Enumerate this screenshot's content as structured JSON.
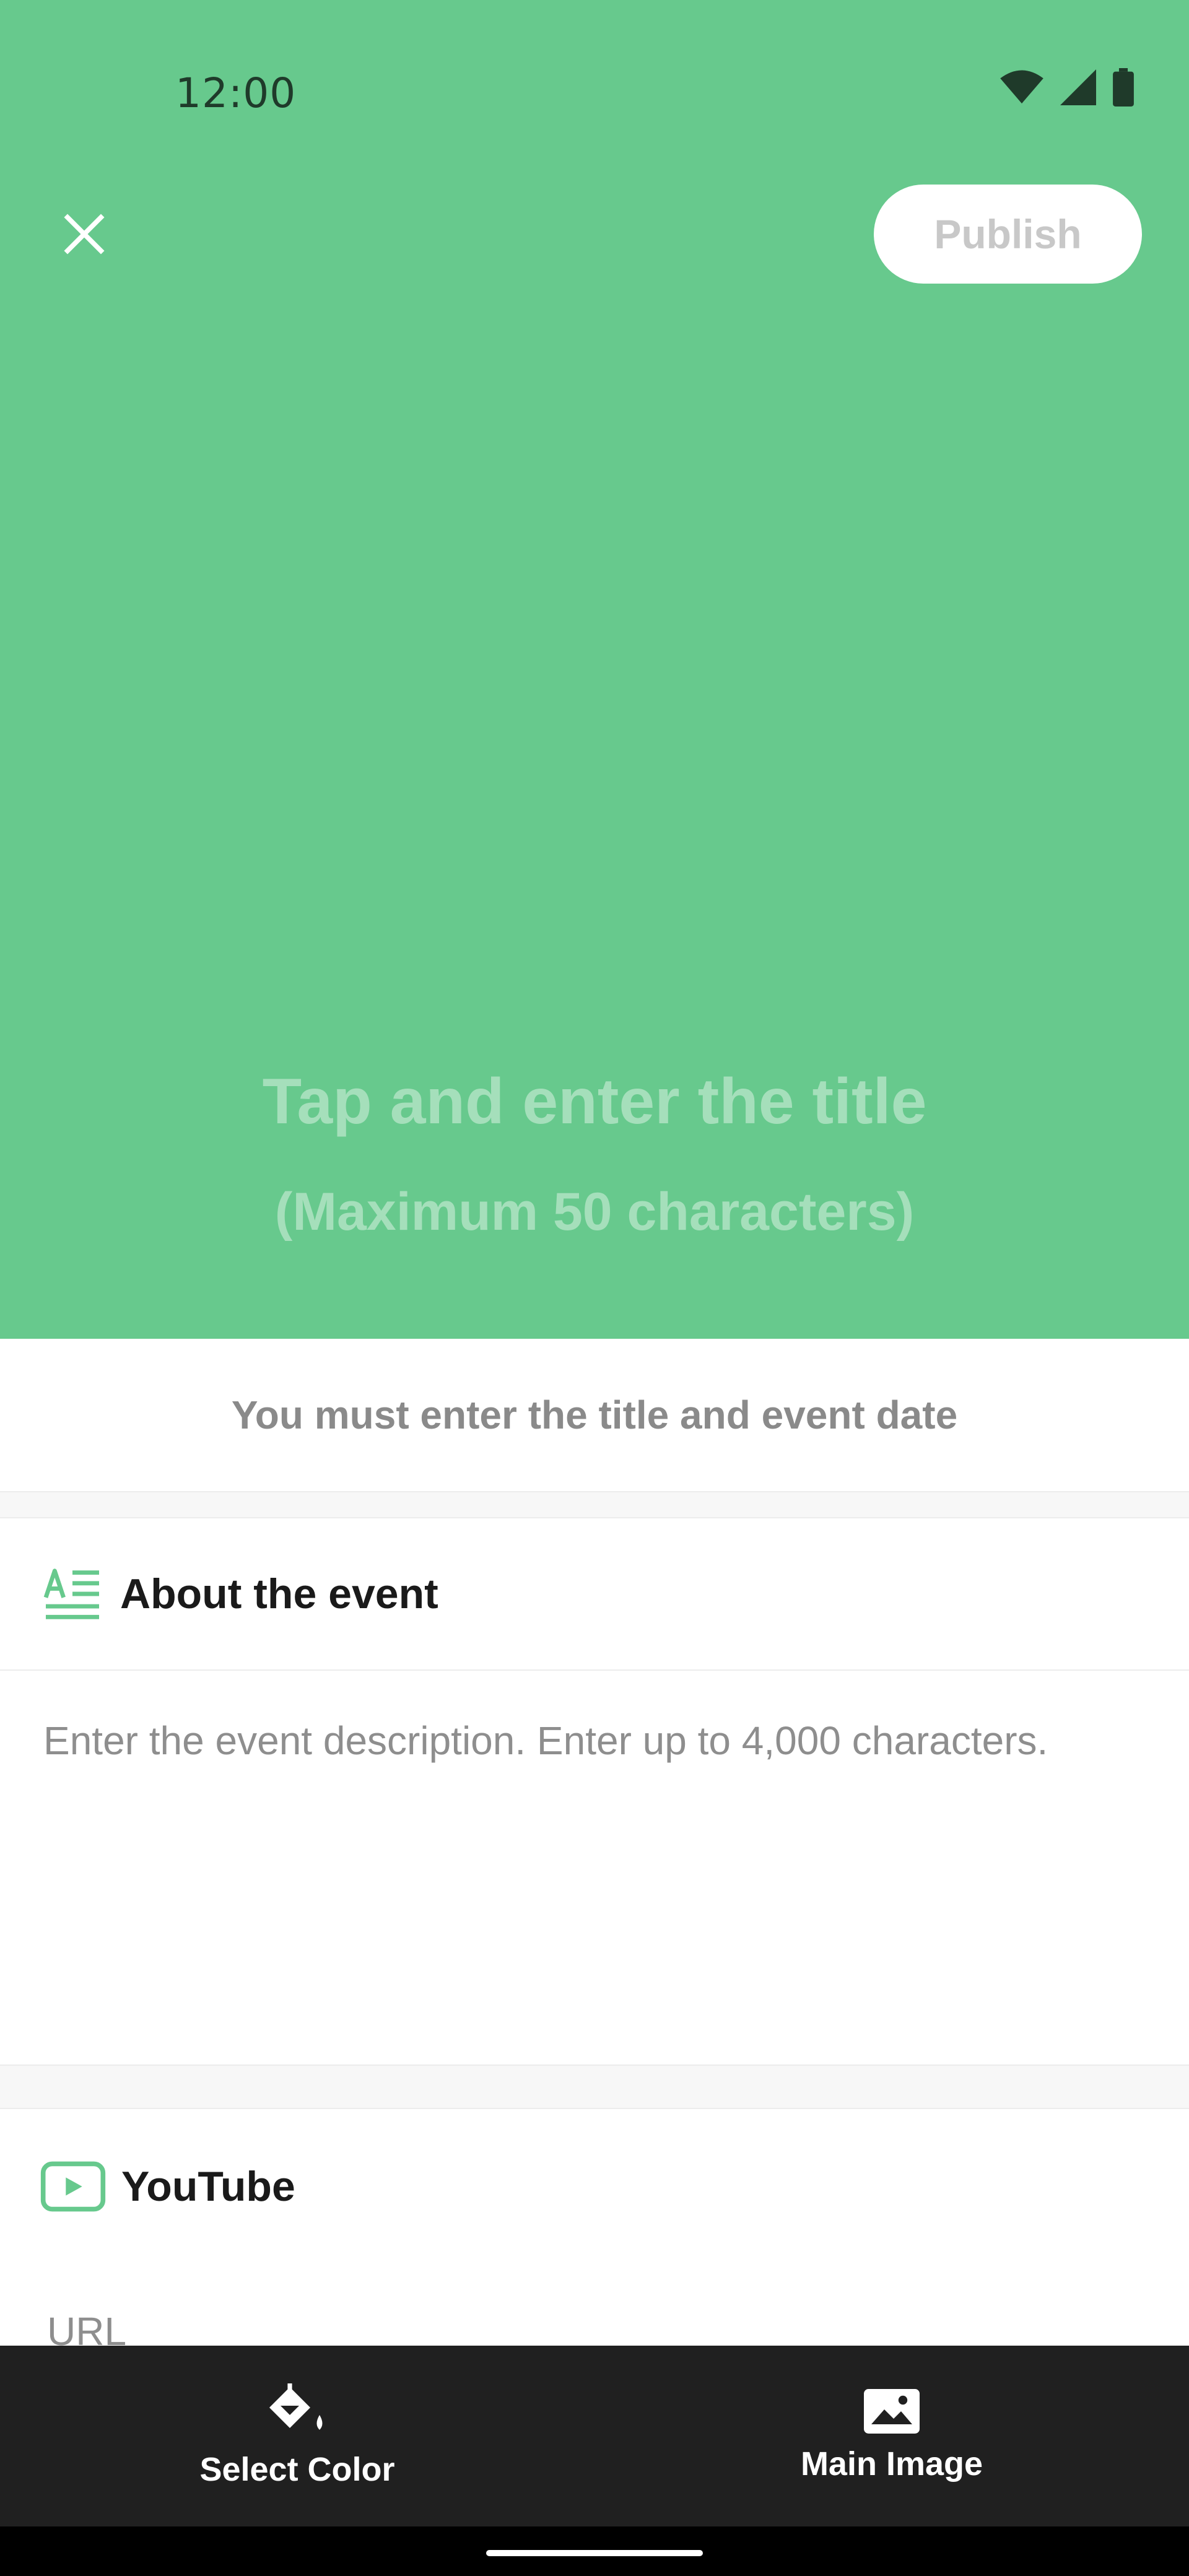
{
  "status_bar": {
    "time": "12:00"
  },
  "header": {
    "close_icon": "close-icon",
    "publish_label": "Publish"
  },
  "hero": {
    "background_color": "#67c98d",
    "title_placeholder": "Tap and enter the title",
    "title_hint": "(Maximum 50 characters)"
  },
  "warning": {
    "text": "You must enter the title and event date"
  },
  "about": {
    "icon": "text-align-icon",
    "label": "About the event",
    "placeholder": "Enter the event description. Enter up to 4,000 characters."
  },
  "youtube": {
    "icon": "youtube-play-icon",
    "label": "YouTube",
    "url_label": "URL"
  },
  "bottom_bar": {
    "select_color": {
      "icon": "paint-bucket-icon",
      "label": "Select Color"
    },
    "main_image": {
      "icon": "image-icon",
      "label": "Main Image"
    }
  },
  "colors": {
    "accent": "#67c98d",
    "bar": "#202020"
  }
}
